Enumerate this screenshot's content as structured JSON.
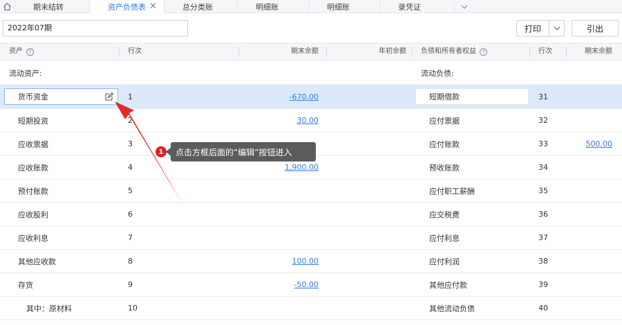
{
  "tabs": [
    {
      "label": "期末结转",
      "active": false
    },
    {
      "label": "资产负债表",
      "active": true
    },
    {
      "label": "总分类账",
      "active": false
    },
    {
      "label": "明细账",
      "active": false
    },
    {
      "label": "明细账",
      "active": false
    },
    {
      "label": "录凭证",
      "active": false
    }
  ],
  "toolbar": {
    "period": "2022年07期",
    "print_label": "打印",
    "import_label": "引出"
  },
  "header": {
    "asset": "资产",
    "row_no": "行次",
    "end_balance": "期末余额",
    "begin_balance": "年初余额",
    "liab": "负债和所有者权益",
    "row_no2": "行次",
    "end_balance2": "期末余额"
  },
  "section": {
    "asset": "流动资产:",
    "liab": "流动负债:"
  },
  "rows": [
    {
      "asset": "货币资金",
      "no": "1",
      "end": "-670.00",
      "liab": "短期借款",
      "liab_no": "31",
      "liab_end": ""
    },
    {
      "asset": "短期投资",
      "no": "2",
      "end": "30.00",
      "liab": "应付票据",
      "liab_no": "32",
      "liab_end": ""
    },
    {
      "asset": "应收票据",
      "no": "3",
      "end": "",
      "liab": "应付账款",
      "liab_no": "33",
      "liab_end": "500.00"
    },
    {
      "asset": "应收账款",
      "no": "4",
      "end": "1,900.00",
      "liab": "预收账款",
      "liab_no": "34",
      "liab_end": ""
    },
    {
      "asset": "预付账款",
      "no": "5",
      "end": "",
      "liab": "应付职工薪酬",
      "liab_no": "35",
      "liab_end": ""
    },
    {
      "asset": "应收股利",
      "no": "6",
      "end": "",
      "liab": "应交税费",
      "liab_no": "36",
      "liab_end": ""
    },
    {
      "asset": "应收利息",
      "no": "7",
      "end": "",
      "liab": "应付利息",
      "liab_no": "37",
      "liab_end": ""
    },
    {
      "asset": "其他应收款",
      "no": "8",
      "end": "100.00",
      "liab": "应付利润",
      "liab_no": "38",
      "liab_end": ""
    },
    {
      "asset": "存货",
      "no": "9",
      "end": "-50.00",
      "liab": "其他应付款",
      "liab_no": "39",
      "liab_end": ""
    },
    {
      "asset": "其中：原材料",
      "no": "10",
      "end": "",
      "liab": "其他流动负债",
      "liab_no": "40",
      "liab_end": ""
    }
  ],
  "callout": {
    "badge": "1",
    "text": "点击方框后面的“编辑”按钮进入"
  },
  "colors": {
    "accent": "#2f7de1",
    "selected_row": "#dce9f8",
    "annotation_red": "#e02020"
  }
}
